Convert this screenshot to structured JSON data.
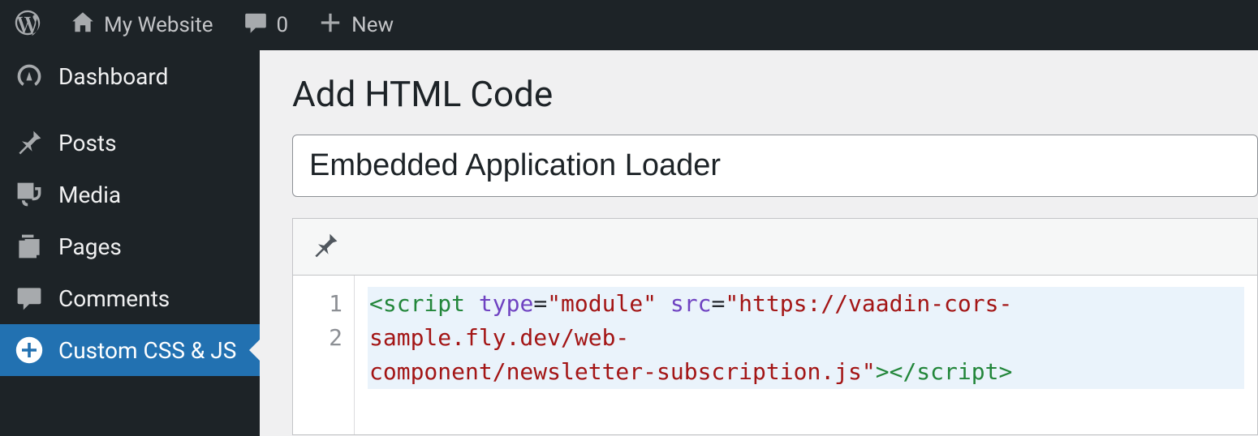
{
  "adminbar": {
    "site_name": "My Website",
    "comment_count": "0",
    "new_label": "New"
  },
  "sidebar": {
    "items": [
      {
        "label": "Dashboard"
      },
      {
        "label": "Posts"
      },
      {
        "label": "Media"
      },
      {
        "label": "Pages"
      },
      {
        "label": "Comments"
      },
      {
        "label": "Custom CSS & JS"
      }
    ]
  },
  "main": {
    "page_title": "Add HTML Code",
    "title_value": "Embedded Application Loader"
  },
  "code": {
    "line1_numbers": "1",
    "line2_numbers": "2",
    "open_tag": "<script",
    "sp1": " ",
    "attr_type": "type",
    "eq": "=",
    "val_type": "\"module\"",
    "sp2": " ",
    "attr_src": "src",
    "val_src_a": "\"https://vaadin-cors-sample.fly.dev/web-",
    "val_src_b": "component/newsletter-subscription.js\"",
    "close1": ">",
    "close_tag": "</script",
    "close2": ">"
  }
}
